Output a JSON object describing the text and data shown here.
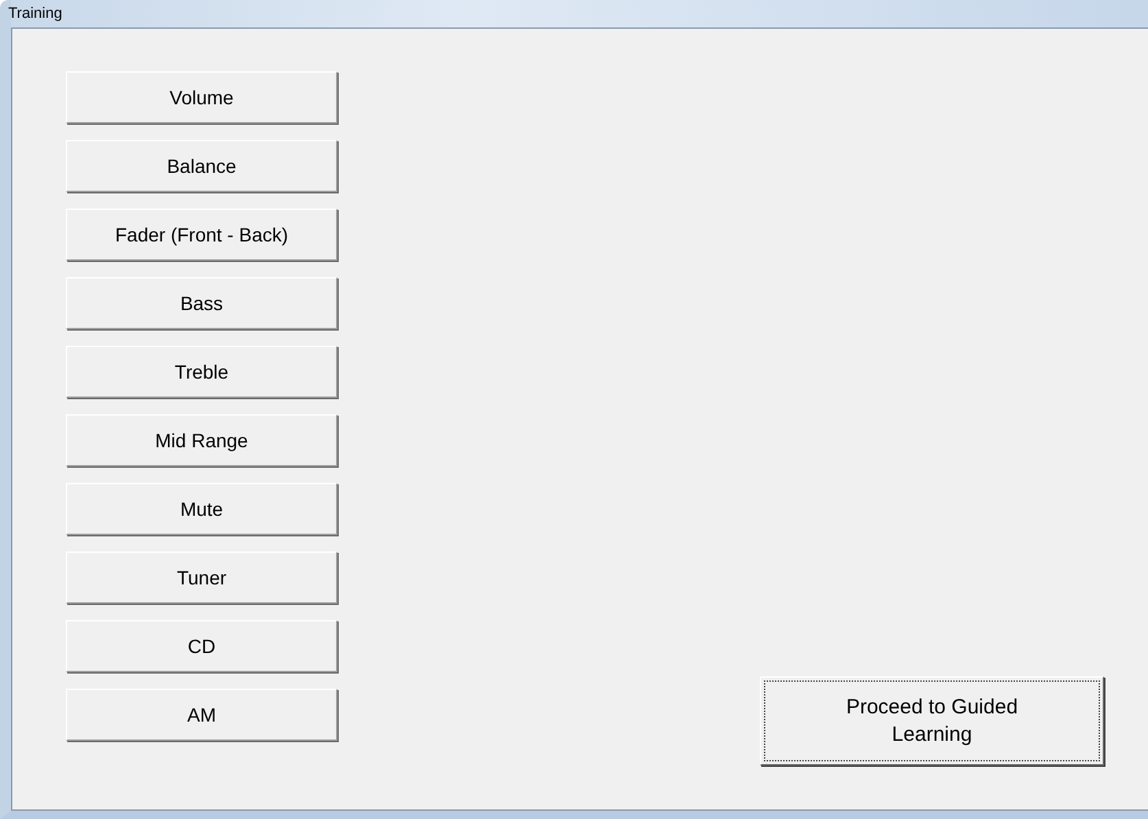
{
  "window": {
    "title": "Training"
  },
  "topic_buttons": [
    {
      "label": "Volume"
    },
    {
      "label": "Balance"
    },
    {
      "label": "Fader (Front - Back)"
    },
    {
      "label": "Bass"
    },
    {
      "label": "Treble"
    },
    {
      "label": "Mid Range"
    },
    {
      "label": "Mute"
    },
    {
      "label": "Tuner"
    },
    {
      "label": "CD"
    },
    {
      "label": "AM"
    }
  ],
  "proceed_button": {
    "label": "Proceed to Guided Learning",
    "focused": true
  }
}
